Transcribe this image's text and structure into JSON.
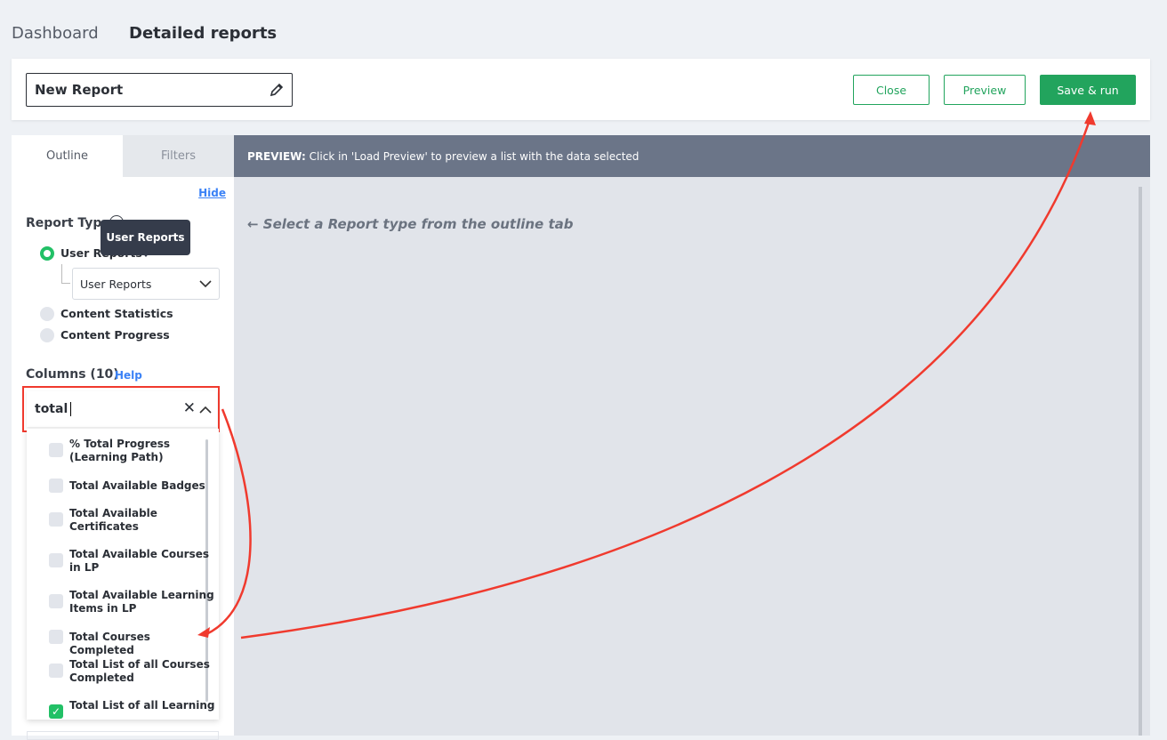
{
  "nav": {
    "tabs": [
      {
        "label": "Dashboard"
      },
      {
        "label": "Detailed reports"
      }
    ]
  },
  "header": {
    "report_name": "New Report",
    "close_label": "Close",
    "preview_label": "Preview",
    "save_run_label": "Save & run"
  },
  "outline": {
    "tabs": [
      {
        "label": "Outline"
      },
      {
        "label": "Filters"
      }
    ],
    "hide_link": "Hide",
    "report_type_label": "Report Type",
    "tooltip": "User Reports",
    "report_types": [
      {
        "label": "User Reports",
        "selected": true
      },
      {
        "label": "Content Statistics",
        "selected": false
      },
      {
        "label": "Content Progress",
        "selected": false
      }
    ],
    "sub_select_value": "User Reports",
    "columns_label": "Columns (10)",
    "help_link": "Help",
    "search_value": "total",
    "options": [
      {
        "label": "% Total Progress (Learning Path)",
        "checked": false
      },
      {
        "label": "Total Available Badges",
        "checked": false
      },
      {
        "label": "Total Available Certificates",
        "checked": false
      },
      {
        "label": "Total Available Courses in LP",
        "checked": false
      },
      {
        "label": "Total Available Learning Items in LP",
        "checked": false
      },
      {
        "label": "Total Courses Completed",
        "checked": false
      },
      {
        "label": "Total List of all Courses Completed",
        "checked": false
      },
      {
        "label": "Total List of all Learning",
        "checked": true
      }
    ]
  },
  "preview": {
    "bar_prefix": "PREVIEW:",
    "bar_text": " Click in 'Load Preview' to preview a list with the data selected",
    "empty_message": "Select a Report type from the outline tab"
  },
  "colors": {
    "accent": "#22a45d",
    "annotation": "#f03a2e",
    "preview_bar": "#6b7588"
  }
}
